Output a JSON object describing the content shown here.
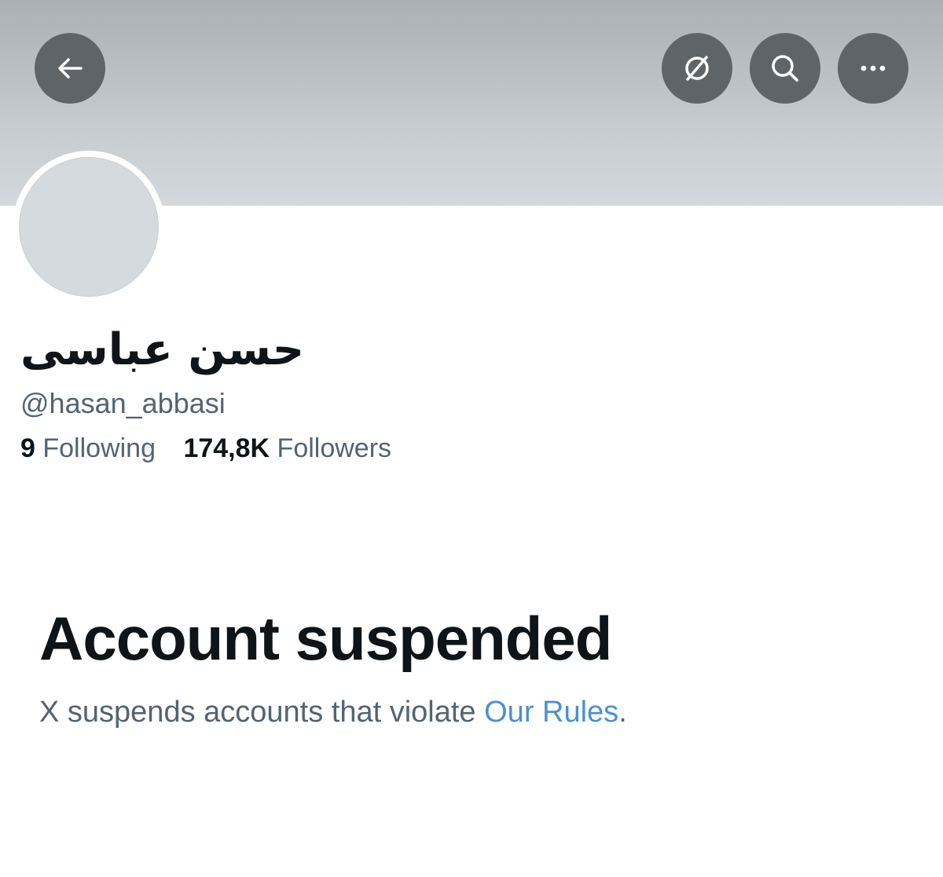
{
  "header": {
    "back_icon": "arrow-left-icon",
    "translate_icon": "translate-off-icon",
    "search_icon": "search-icon",
    "more_icon": "ellipsis-icon"
  },
  "profile": {
    "display_name": "حسن عباسی",
    "handle": "@hasan_abbasi",
    "following_count": "9",
    "following_label": "Following",
    "followers_count": "174,8K",
    "followers_label": "Followers"
  },
  "suspension": {
    "title": "Account suspended",
    "description": "X suspends accounts that violate ",
    "link_text": "Our Rules",
    "trailing": "."
  },
  "colors": {
    "banner": "#b9c0c5",
    "button_bg": "#5f6468",
    "text_primary": "#0f1419",
    "text_secondary": "#536471",
    "link": "#4a90d2"
  }
}
